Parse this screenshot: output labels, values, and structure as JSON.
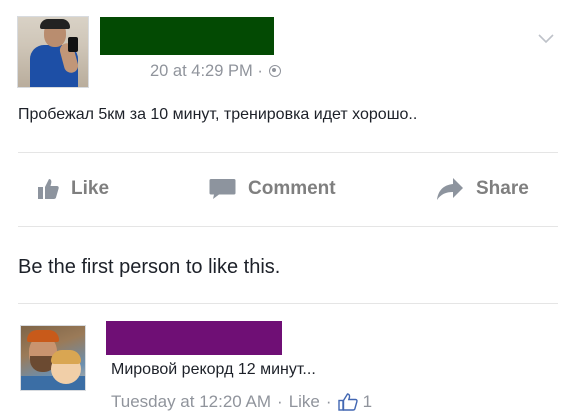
{
  "post": {
    "timestamp": "20 at 4:29 PM",
    "meta_separator": "·",
    "privacy_icon": "globe-icon",
    "menu_icon": "chevron-down-icon",
    "text": "Пробежал 5км за 10 минут, тренировка идет хорошо..",
    "name_redaction_color": "#034a03"
  },
  "actions": {
    "like_label": "Like",
    "comment_label": "Comment",
    "share_label": "Share"
  },
  "likes_prompt": "Be the first person to like this.",
  "comment": {
    "text": "Мировой рекорд 12 минут...",
    "time": "Tuesday at 12:20 AM",
    "separator": "·",
    "like_label": "Like",
    "like_count": "1",
    "name_redaction_color": "#6f0f75"
  }
}
